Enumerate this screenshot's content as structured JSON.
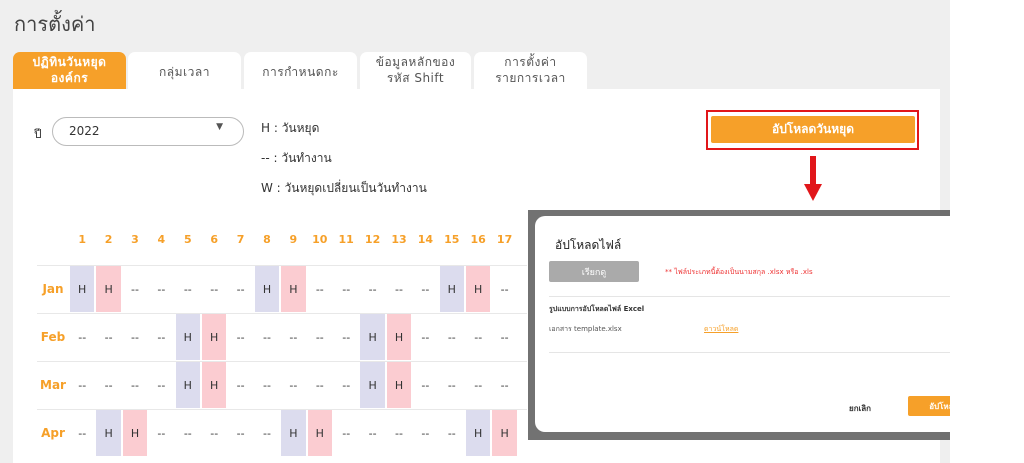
{
  "page": {
    "title": "การตั้งค่า"
  },
  "tabs": [
    {
      "line1": "ปฏิทินวันหยุด",
      "line2": "องค์กร"
    },
    {
      "line1": "กลุ่มเวลา",
      "line2": ""
    },
    {
      "line1": "การกำหนดกะ",
      "line2": ""
    },
    {
      "line1": "ข้อมูลหลักของ",
      "line2": "รหัส Shift"
    },
    {
      "line1": "การตั้งค่า",
      "line2": "รายการเวลา"
    }
  ],
  "year": {
    "label": "ปี",
    "value": "2022"
  },
  "legend": [
    "H : วันหยุด",
    "-- : วันทำงาน",
    "W : วันหยุดเปลี่ยนเป็นวันทำงาน"
  ],
  "upload_holiday_button": "อัปโหลดวันหยุด",
  "calendar": {
    "days": [
      "1",
      "2",
      "3",
      "4",
      "5",
      "6",
      "7",
      "8",
      "9",
      "10",
      "11",
      "12",
      "13",
      "14",
      "15",
      "16",
      "17"
    ],
    "rows": [
      {
        "month": "Jan",
        "cells": [
          "H",
          "H",
          "--",
          "--",
          "--",
          "--",
          "--",
          "H",
          "H",
          "--",
          "--",
          "--",
          "--",
          "--",
          "H",
          "H",
          "--"
        ]
      },
      {
        "month": "Feb",
        "cells": [
          "--",
          "--",
          "--",
          "--",
          "H",
          "H",
          "--",
          "--",
          "--",
          "--",
          "--",
          "H",
          "H",
          "--",
          "--",
          "--",
          "--"
        ]
      },
      {
        "month": "Mar",
        "cells": [
          "--",
          "--",
          "--",
          "--",
          "H",
          "H",
          "--",
          "--",
          "--",
          "--",
          "--",
          "H",
          "H",
          "--",
          "--",
          "--",
          "--"
        ]
      },
      {
        "month": "Apr",
        "cells": [
          "--",
          "H",
          "H",
          "--",
          "--",
          "--",
          "--",
          "--",
          "H",
          "H",
          "--",
          "--",
          "--",
          "--",
          "--",
          "H",
          "H"
        ]
      }
    ]
  },
  "modal": {
    "title": "อัปโหลดไฟล์",
    "browse_button": "เรียกดู",
    "note": "** ไฟล์ประเภทนี้ต้องเป็นนามสกุล .xlsx หรือ .xls",
    "format_title": "รูปแบบการอัปโหลดไฟล์ Excel",
    "template_file": "เอกสาร template.xlsx",
    "download_link": "ดาวน์โหลด",
    "cancel": "ยกเลิก",
    "upload": "อัปโหลด"
  }
}
